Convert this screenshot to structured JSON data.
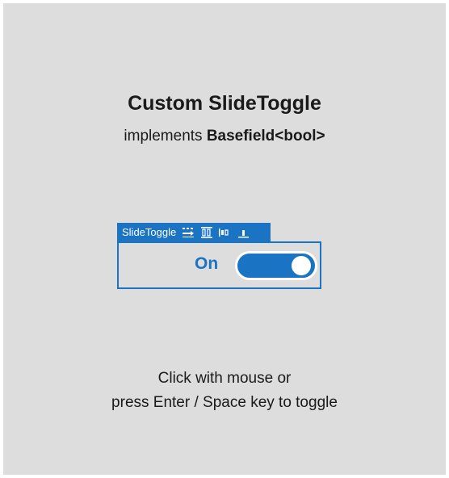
{
  "header": {
    "title": "Custom SlideToggle",
    "subtitle_prefix": "implements ",
    "subtitle_strong": "Basefield<bool>"
  },
  "toggle": {
    "tab_label": "SlideToggle",
    "state_label": "On",
    "is_on": true,
    "accent_color": "#1b73c4",
    "tab_icons": [
      "arrange-right-icon",
      "align-columns-icon",
      "align-left-bars-icon",
      "align-bottom-icon"
    ]
  },
  "instructions": {
    "line1": "Click with mouse or",
    "line2": "press Enter / Space key to toggle"
  }
}
